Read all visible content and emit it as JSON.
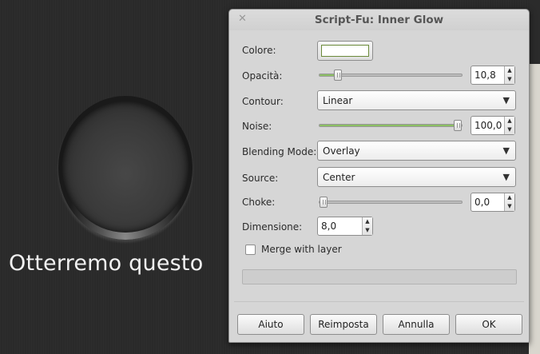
{
  "canvas": {
    "caption": "Otterremo questo"
  },
  "dialog": {
    "title": "Script-Fu: Inner Glow",
    "close_icon": "close-icon",
    "fields": {
      "color": {
        "label": "Colore:",
        "value": "#ffffff"
      },
      "opacity": {
        "label": "Opacità:",
        "value": "10,8",
        "level": 0.108
      },
      "contour": {
        "label": "Contour:",
        "value": "Linear"
      },
      "noise": {
        "label": "Noise:",
        "value": "100,0",
        "level": 1.0
      },
      "blending_mode": {
        "label": "Blending Mode:",
        "value": "Overlay"
      },
      "source": {
        "label": "Source:",
        "value": "Center"
      },
      "choke": {
        "label": "Choke:",
        "value": "0,0",
        "level": 0.0
      },
      "size": {
        "label": "Dimensione:",
        "value": "8,0"
      },
      "merge": {
        "label": "Merge with layer",
        "checked": false
      }
    },
    "progress": 0,
    "buttons": {
      "help": "Aiuto",
      "reset": "Reimposta",
      "cancel": "Annulla",
      "ok": "OK"
    },
    "accent_color": "#8cc063"
  }
}
